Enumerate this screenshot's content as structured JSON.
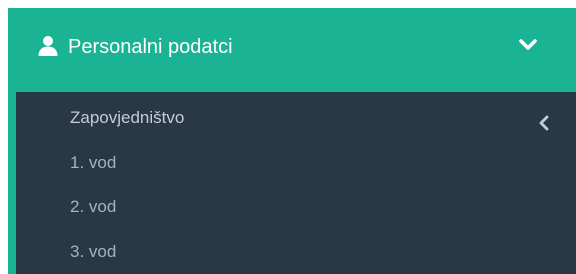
{
  "menu": {
    "title": "Personalni podatci",
    "icon": "user-icon",
    "expand_icon": "chevron-down-icon",
    "collapse_icon": "chevron-left-icon",
    "colors": {
      "header_bg": "#1ab394",
      "submenu_bg": "#293846",
      "text": "#a7b1c2"
    },
    "items": [
      {
        "label": "Zapovjedništvo"
      },
      {
        "label": "1. vod"
      },
      {
        "label": "2. vod"
      },
      {
        "label": "3. vod"
      }
    ]
  }
}
